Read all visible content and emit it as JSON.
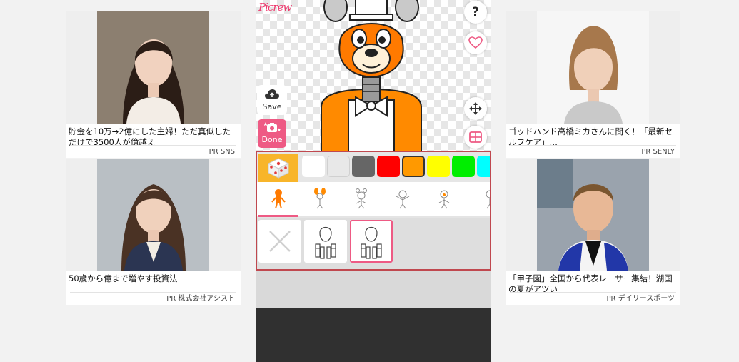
{
  "ads": [
    {
      "caption": "貯金を10万→2億にした主婦！ただ真似しただけで3500人が億越え",
      "source": "PR SNS"
    },
    {
      "caption": "50歳から億まで増やす投資法",
      "source": "PR 株式会社アシスト"
    },
    {
      "caption": "ゴッドハンド高橋ミカさんに聞く！「最新セルフケア」…",
      "source": "PR SENLY"
    },
    {
      "caption": "「甲子園」全国から代表レーサー集結！湖国の夏がアツい",
      "source": "PR デイリースポーツ"
    }
  ],
  "app": {
    "logo": "Picrew",
    "help_label": "?",
    "save_label": "Save",
    "done_label": "Done"
  },
  "colors": [
    "#ffffff",
    "#e8e8e8",
    "#666666",
    "#ff0000",
    "#ff9900",
    "#ffff00",
    "#00ee00",
    "#00ffff"
  ],
  "selected_color": "#ff9900",
  "accent": "#ee5a84"
}
